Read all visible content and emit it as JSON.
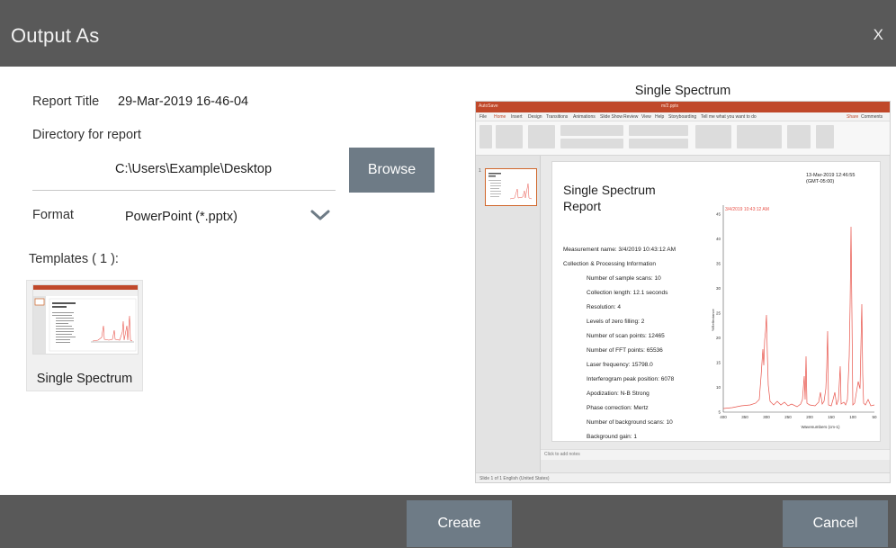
{
  "dialog": {
    "title": "Output As",
    "close_label": "X"
  },
  "form": {
    "report_title_label": "Report Title",
    "report_title_value": "29-Mar-2019 16-46-04",
    "directory_label": "Directory for report",
    "directory_value": "C:\\Users\\Example\\Desktop",
    "browse_label": "Browse",
    "format_label": "Format",
    "format_value": "PowerPoint (*.pptx)"
  },
  "templates": {
    "header": "Templates ( 1 ):",
    "items": [
      {
        "name": "Single Spectrum"
      }
    ]
  },
  "preview": {
    "title": "Single Spectrum",
    "app": {
      "window_title": "m/2.pptx",
      "autosave": "AutoSave",
      "tabs": [
        "File",
        "Home",
        "Insert",
        "Design",
        "Transitions",
        "Animations",
        "Slide Show",
        "Review",
        "View",
        "Help",
        "Storyboarding",
        "Tell me what you want to do"
      ],
      "share": "Share",
      "comments": "Comments",
      "notes_placeholder": "Click to add notes",
      "status": "Slide 1 of 1   English (United States)",
      "slide_number": "1"
    },
    "slide": {
      "title_line1": "Single Spectrum",
      "title_line2": "Report",
      "date": "13-Mar-2019 12:46:55 (GMT-05:00)",
      "lines": [
        {
          "text": "Measurement name: 3/4/2019 10:43:12 AM",
          "indent": false
        },
        {
          "text": "Collection & Processing Information",
          "indent": false
        },
        {
          "text": "Number of sample scans: 10",
          "indent": true
        },
        {
          "text": "Collection length: 12.1 seconds",
          "indent": true
        },
        {
          "text": "Resolution: 4",
          "indent": true
        },
        {
          "text": "Levels of zero filling: 2",
          "indent": true
        },
        {
          "text": "Number of scan points: 12465",
          "indent": true
        },
        {
          "text": "Number of FFT points: 65536",
          "indent": true
        },
        {
          "text": "Laser frequency: 15798.0",
          "indent": true
        },
        {
          "text": "Interferogram peak position: 6078",
          "indent": true
        },
        {
          "text": "Apodization: N-B Strong",
          "indent": true
        },
        {
          "text": "Phase correction: Mertz",
          "indent": true
        },
        {
          "text": "Number of background scans: 10",
          "indent": true
        },
        {
          "text": "Background gain: 1",
          "indent": true
        }
      ],
      "chart": {
        "legend": "3/4/2019 10:43:12 AM",
        "ylabel": "%Reflectance",
        "xlabel": "Wavenumbers (cm-1)",
        "xticks": [
          "400",
          "350",
          "300",
          "250",
          "200",
          "150",
          "100",
          "50"
        ],
        "yticks": [
          "45",
          "40",
          "35",
          "30",
          "25",
          "20",
          "15",
          "10",
          "5"
        ],
        "line_color": "#e8534a"
      }
    }
  },
  "buttons": {
    "create": "Create",
    "cancel": "Cancel"
  },
  "colors": {
    "titlebar": "#595959",
    "button": "#6e7b86",
    "accent": "#c0482a"
  }
}
